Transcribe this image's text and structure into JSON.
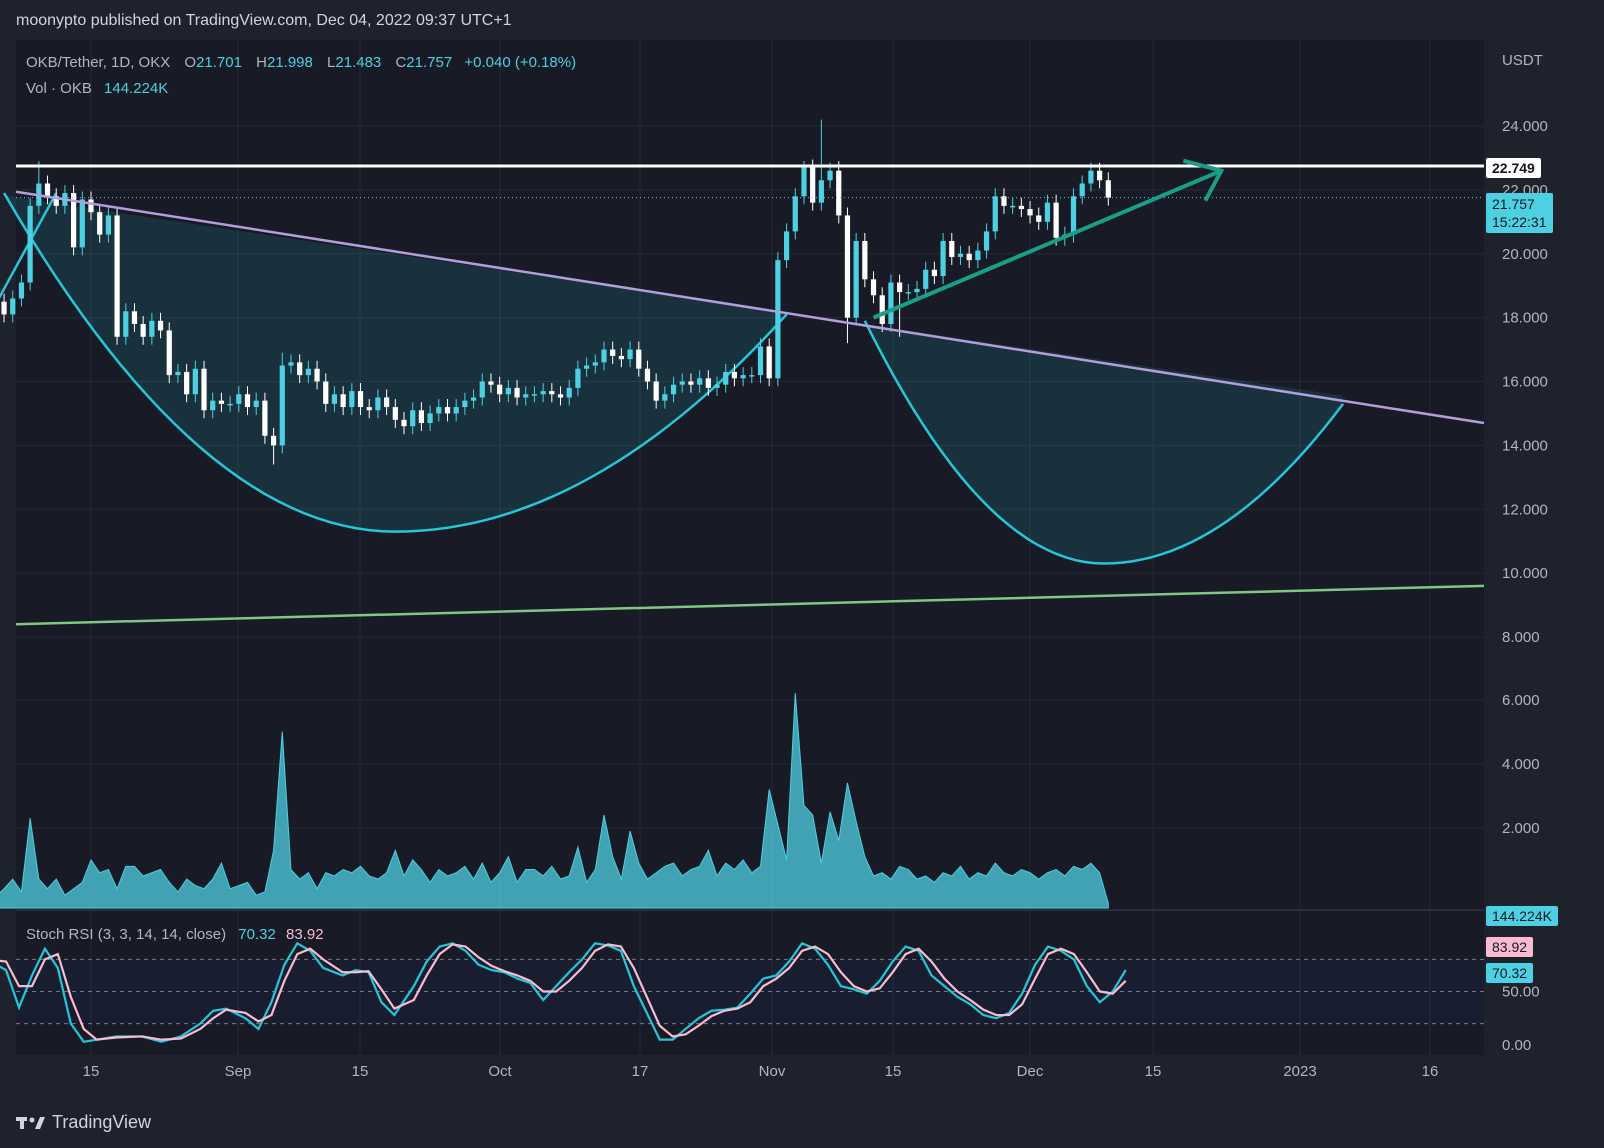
{
  "header": {
    "published": "moonypto published on TradingView.com, Dec 04, 2022 09:37 UTC+1"
  },
  "legend": {
    "symbol": "OKB/Tether, 1D, OKX",
    "open_label": "O",
    "open": "21.701",
    "high_label": "H",
    "high": "21.998",
    "low_label": "L",
    "low": "21.483",
    "close_label": "C",
    "close": "21.757",
    "change": "+0.040 (+0.18%)",
    "vol_label": "Vol · OKB",
    "vol": "144.224K",
    "stoch_label": "Stoch RSI (3, 3, 14, 14, close)",
    "stoch_k": "70.32",
    "stoch_d": "83.92"
  },
  "axis": {
    "currency": "USDT",
    "price_tag": "22.749",
    "last_price": "21.757",
    "countdown": "15:22:31",
    "volume_tag": "144.224K",
    "stoch_k_tag": "70.32",
    "stoch_d_tag": "83.92"
  },
  "brand": {
    "name": "TradingView"
  },
  "colors": {
    "bg": "#1e222d",
    "up": "#4dd0e1",
    "down": "#ffffff",
    "arc": "#26c6da",
    "trend": "#b39ddb",
    "support": "#81c784",
    "arrow": "#1b9e87",
    "stoch_k": "#26c6da",
    "stoch_d": "#f8bbd0"
  },
  "chart_data": [
    {
      "type": "candlestick",
      "ylim": [
        7,
        25.5
      ],
      "y_ticks": [
        "24.000",
        "22.000",
        "20.000",
        "18.000",
        "16.000",
        "14.000",
        "12.000",
        "10.000",
        "8.000"
      ],
      "y_tick_values": [
        24,
        22,
        20,
        18,
        16,
        14,
        12,
        10,
        8
      ],
      "x_tick_labels": [
        "15",
        "Sep",
        "15",
        "Oct",
        "17",
        "Nov",
        "15",
        "Dec",
        "15",
        "2023",
        "16"
      ],
      "x_tick_dates": [
        "2022-08-15",
        "2022-09-01",
        "2022-09-15",
        "2022-10-01",
        "2022-10-17",
        "2022-11-01",
        "2022-11-15",
        "2022-12-01",
        "2022-12-15",
        "2023-01-01",
        "2023-01-16"
      ],
      "start_date": "2022-08-03",
      "closes": [
        18.3,
        18.5,
        18.1,
        18.6,
        19.1,
        21.5,
        22.2,
        21.8,
        21.5,
        21.9,
        20.2,
        21.7,
        21.3,
        20.6,
        21.2,
        17.4,
        18.2,
        17.8,
        17.4,
        17.9,
        17.6,
        16.2,
        16.3,
        15.6,
        16.4,
        15.1,
        15.4,
        15.3,
        15.3,
        15.6,
        15.2,
        15.4,
        14.3,
        14.0,
        16.5,
        16.6,
        16.2,
        16.4,
        16.0,
        15.3,
        15.6,
        15.2,
        15.7,
        15.2,
        15.1,
        15.5,
        15.2,
        14.8,
        14.6,
        15.1,
        14.7,
        15.0,
        15.2,
        15.0,
        15.2,
        15.4,
        15.5,
        16.0,
        15.9,
        15.6,
        15.8,
        15.5,
        15.6,
        15.6,
        15.7,
        15.6,
        15.5,
        15.8,
        16.4,
        16.5,
        16.6,
        17.0,
        16.8,
        16.7,
        17.0,
        16.4,
        16.0,
        15.4,
        15.6,
        15.9,
        16.0,
        15.9,
        16.1,
        15.8,
        15.9,
        16.3,
        16.1,
        16.2,
        16.2,
        17.1,
        16.1,
        19.8,
        20.7,
        21.8,
        22.7,
        21.6,
        22.3,
        22.6,
        21.2,
        18.0,
        20.4,
        19.2,
        18.7,
        17.8,
        19.1,
        18.8,
        18.8,
        18.9,
        19.5,
        19.3,
        20.4,
        19.9,
        20.0,
        19.8,
        20.1,
        20.7,
        21.8,
        21.5,
        21.5,
        21.4,
        21.2,
        21.0,
        21.6,
        20.5,
        20.6,
        21.8,
        22.2,
        22.6,
        22.3,
        21.757
      ],
      "events": [
        {
          "i": 6,
          "high": 22.9
        },
        {
          "i": 33,
          "low": 13.4
        },
        {
          "i": 34,
          "high": 16.9
        },
        {
          "i": 94,
          "high": 22.9
        },
        {
          "i": 96,
          "high": 24.2
        },
        {
          "i": 98,
          "high": 22.9
        },
        {
          "i": 99,
          "low": 17.2
        },
        {
          "i": 105,
          "low": 17.4
        }
      ]
    },
    {
      "type": "area",
      "ylim": [
        0,
        7
      ],
      "y_ticks": [
        "6.000",
        "4.000",
        "2.000"
      ],
      "y_tick_values": [
        6,
        4,
        2
      ],
      "series_note_unit": "K",
      "values": [
        0.25,
        0.35,
        0.6,
        0.9,
        0.5,
        2.8,
        0.9,
        0.6,
        0.9,
        0.4,
        0.6,
        0.8,
        1.5,
        1.1,
        1.2,
        0.6,
        1.3,
        1.3,
        1.0,
        1.1,
        1.2,
        0.8,
        0.5,
        0.9,
        0.7,
        0.6,
        0.9,
        1.4,
        0.6,
        0.7,
        0.8,
        0.4,
        0.5,
        1.8,
        5.5,
        1.2,
        0.9,
        1.1,
        0.6,
        1.1,
        1.0,
        1.2,
        1.1,
        1.3,
        1.0,
        0.9,
        1.1,
        1.8,
        1.0,
        1.5,
        1.2,
        0.8,
        1.2,
        1.0,
        1.1,
        1.3,
        0.9,
        1.4,
        0.8,
        1.1,
        1.6,
        0.8,
        1.2,
        1.2,
        1.0,
        1.3,
        0.9,
        1.0,
        1.9,
        0.8,
        1.2,
        2.9,
        1.6,
        0.9,
        2.4,
        1.4,
        0.9,
        1.1,
        1.3,
        1.4,
        1.0,
        1.2,
        1.3,
        1.8,
        1.0,
        1.4,
        1.2,
        1.5,
        1.1,
        1.3,
        3.7,
        2.6,
        1.5,
        6.7,
        3.2,
        2.9,
        1.4,
        3.0,
        2.1,
        3.9,
        2.7,
        1.6,
        1.0,
        1.1,
        0.9,
        1.3,
        1.2,
        0.9,
        1.0,
        0.8,
        1.1,
        1.0,
        1.3,
        0.9,
        1.1,
        1.0,
        1.4,
        1.1,
        1.0,
        1.2,
        1.1,
        0.9,
        1.1,
        1.2,
        1.0,
        1.3,
        1.2,
        1.4,
        1.1,
        0.144224
      ]
    },
    {
      "type": "line",
      "ylim": [
        -5,
        110
      ],
      "y_ticks": [
        "50.00",
        "0.00"
      ],
      "y_tick_values": [
        50,
        0
      ],
      "dashed_levels": [
        80,
        50,
        20
      ],
      "series": [
        {
          "key": "k",
          "points": [
            [
              0,
              80
            ],
            [
              3,
              70
            ],
            [
              5,
              35
            ],
            [
              7,
              65
            ],
            [
              9,
              90
            ],
            [
              11,
              72
            ],
            [
              13,
              20
            ],
            [
              15,
              3
            ],
            [
              17,
              5
            ],
            [
              20,
              8
            ],
            [
              24,
              8
            ],
            [
              27,
              3
            ],
            [
              30,
              8
            ],
            [
              33,
              20
            ],
            [
              35,
              32
            ],
            [
              37,
              34
            ],
            [
              40,
              25
            ],
            [
              42,
              15
            ],
            [
              44,
              40
            ],
            [
              46,
              75
            ],
            [
              48,
              95
            ],
            [
              50,
              88
            ],
            [
              52,
              72
            ],
            [
              55,
              65
            ],
            [
              57,
              70
            ],
            [
              59,
              68
            ],
            [
              61,
              40
            ],
            [
              63,
              28
            ],
            [
              66,
              55
            ],
            [
              68,
              78
            ],
            [
              70,
              92
            ],
            [
              72,
              95
            ],
            [
              74,
              88
            ],
            [
              76,
              75
            ],
            [
              78,
              70
            ],
            [
              80,
              68
            ],
            [
              82,
              62
            ],
            [
              84,
              58
            ],
            [
              86,
              42
            ],
            [
              88,
              55
            ],
            [
              90,
              68
            ],
            [
              92,
              80
            ],
            [
              94,
              95
            ],
            [
              96,
              93
            ],
            [
              98,
              88
            ],
            [
              100,
              55
            ],
            [
              102,
              30
            ],
            [
              104,
              5
            ],
            [
              106,
              5
            ],
            [
              108,
              15
            ],
            [
              110,
              25
            ],
            [
              112,
              32
            ],
            [
              114,
              33
            ],
            [
              116,
              35
            ],
            [
              118,
              48
            ],
            [
              120,
              62
            ],
            [
              122,
              65
            ],
            [
              124,
              78
            ],
            [
              126,
              95
            ],
            [
              128,
              90
            ],
            [
              130,
              75
            ],
            [
              132,
              55
            ],
            [
              134,
              52
            ],
            [
              136,
              48
            ],
            [
              138,
              60
            ],
            [
              140,
              78
            ],
            [
              142,
              92
            ],
            [
              144,
              88
            ],
            [
              146,
              65
            ],
            [
              148,
              55
            ],
            [
              150,
              45
            ],
            [
              152,
              38
            ],
            [
              154,
              28
            ],
            [
              156,
              25
            ],
            [
              158,
              30
            ],
            [
              160,
              48
            ],
            [
              162,
              75
            ],
            [
              164,
              92
            ],
            [
              166,
              88
            ],
            [
              168,
              80
            ],
            [
              170,
              55
            ],
            [
              172,
              40
            ],
            [
              174,
              50
            ],
            [
              176,
              70
            ]
          ]
        },
        {
          "key": "d",
          "points": [
            [
              0,
              80
            ],
            [
              3,
              78
            ],
            [
              5,
              55
            ],
            [
              7,
              55
            ],
            [
              9,
              80
            ],
            [
              11,
              85
            ],
            [
              13,
              45
            ],
            [
              15,
              15
            ],
            [
              17,
              5
            ],
            [
              20,
              7
            ],
            [
              24,
              8
            ],
            [
              27,
              5
            ],
            [
              30,
              6
            ],
            [
              33,
              15
            ],
            [
              35,
              25
            ],
            [
              37,
              33
            ],
            [
              40,
              30
            ],
            [
              42,
              22
            ],
            [
              44,
              28
            ],
            [
              46,
              60
            ],
            [
              48,
              85
            ],
            [
              50,
              90
            ],
            [
              52,
              80
            ],
            [
              55,
              68
            ],
            [
              57,
              68
            ],
            [
              59,
              69
            ],
            [
              61,
              52
            ],
            [
              63,
              34
            ],
            [
              66,
              42
            ],
            [
              68,
              65
            ],
            [
              70,
              85
            ],
            [
              72,
              94
            ],
            [
              74,
              92
            ],
            [
              76,
              82
            ],
            [
              78,
              74
            ],
            [
              80,
              69
            ],
            [
              82,
              65
            ],
            [
              84,
              60
            ],
            [
              86,
              50
            ],
            [
              88,
              50
            ],
            [
              90,
              60
            ],
            [
              92,
              72
            ],
            [
              94,
              88
            ],
            [
              96,
              94
            ],
            [
              98,
              92
            ],
            [
              100,
              72
            ],
            [
              102,
              45
            ],
            [
              104,
              18
            ],
            [
              106,
              8
            ],
            [
              108,
              10
            ],
            [
              110,
              18
            ],
            [
              112,
              27
            ],
            [
              114,
              32
            ],
            [
              116,
              34
            ],
            [
              118,
              40
            ],
            [
              120,
              55
            ],
            [
              122,
              62
            ],
            [
              124,
              72
            ],
            [
              126,
              88
            ],
            [
              128,
              92
            ],
            [
              130,
              85
            ],
            [
              132,
              68
            ],
            [
              134,
              55
            ],
            [
              136,
              50
            ],
            [
              138,
              53
            ],
            [
              140,
              68
            ],
            [
              142,
              85
            ],
            [
              144,
              90
            ],
            [
              146,
              78
            ],
            [
              148,
              62
            ],
            [
              150,
              50
            ],
            [
              152,
              42
            ],
            [
              154,
              33
            ],
            [
              156,
              28
            ],
            [
              158,
              28
            ],
            [
              160,
              38
            ],
            [
              162,
              62
            ],
            [
              164,
              85
            ],
            [
              166,
              90
            ],
            [
              168,
              85
            ],
            [
              170,
              68
            ],
            [
              172,
              50
            ],
            [
              174,
              48
            ],
            [
              176,
              60
            ]
          ]
        }
      ]
    }
  ]
}
